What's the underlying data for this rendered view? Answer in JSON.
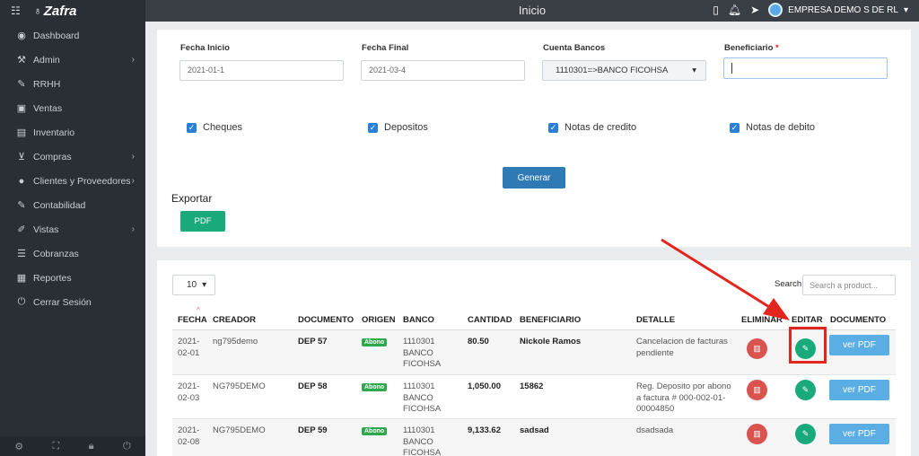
{
  "app": {
    "name": "Zafra"
  },
  "header": {
    "title": "Inicio",
    "org": "EMPRESA DEMO S DE RL",
    "org_caret": "▾"
  },
  "sidebar": {
    "items": [
      {
        "label": "Dashboard",
        "icon": "dashboard-icon",
        "glyph": "◉",
        "chevron": false
      },
      {
        "label": "Admin",
        "icon": "wrench-icon",
        "glyph": "⚒",
        "chevron": true
      },
      {
        "label": "RRHH",
        "icon": "tag-icon",
        "glyph": "✎",
        "chevron": false
      },
      {
        "label": "Ventas",
        "icon": "money-icon",
        "glyph": "▣",
        "chevron": false
      },
      {
        "label": "Inventario",
        "icon": "book-icon",
        "glyph": "▤",
        "chevron": false
      },
      {
        "label": "Compras",
        "icon": "cart-icon",
        "glyph": "⊻",
        "chevron": true
      },
      {
        "label": "Clientes y Proveedores",
        "icon": "user-icon",
        "glyph": "●",
        "chevron": true
      },
      {
        "label": "Contabilidad",
        "icon": "pencil-icon",
        "glyph": "✎",
        "chevron": false
      },
      {
        "label": "Vistas",
        "icon": "edit-icon",
        "glyph": "✐",
        "chevron": true
      },
      {
        "label": "Cobranzas",
        "icon": "list-icon",
        "glyph": "☰",
        "chevron": false
      },
      {
        "label": "Reportes",
        "icon": "report-icon",
        "glyph": "▦",
        "chevron": false
      },
      {
        "label": "Cerrar Sesión",
        "icon": "power-icon",
        "glyph": "⏻",
        "chevron": false
      }
    ]
  },
  "filters": {
    "fecha_inicio_label": "Fecha Inicio",
    "fecha_inicio_value": "2021-01-1",
    "fecha_final_label": "Fecha Final",
    "fecha_final_value": "2021-03-4",
    "cuenta_label": "Cuenta Bancos",
    "cuenta_value": "1110301=>BANCO FICOHSA",
    "beneficiario_label": "Beneficiario",
    "beneficiario_required": "*",
    "beneficiario_value": ""
  },
  "checkboxes": [
    {
      "label": "Cheques",
      "checked": true
    },
    {
      "label": "Depositos",
      "checked": true
    },
    {
      "label": "Notas de credito",
      "checked": true
    },
    {
      "label": "Notas de debito",
      "checked": true
    }
  ],
  "actions": {
    "generar": "Generar",
    "exportar": "Exportar",
    "pdf": "PDF"
  },
  "table": {
    "length": "10",
    "search_label": "Search:",
    "search_placeholder": "Search a product...",
    "columns": [
      "FECHA",
      "CREADOR",
      "DOCUMENTO",
      "ORIGEN",
      "BANCO",
      "CANTIDAD",
      "BENEFICIARIO",
      "DETALLE",
      "ELIMINAR",
      "EDITAR",
      "DOCUMENTO"
    ],
    "ver_pdf": "ver PDF",
    "rows": [
      {
        "fecha": [
          "2021-",
          "02-01"
        ],
        "creador": "ng795demo",
        "documento": "DEP 57",
        "origen": "Abono",
        "banco": [
          "1110301",
          "BANCO",
          "FICOHSA"
        ],
        "cantidad": "80.50",
        "beneficiario": "Nickole Ramos",
        "detalle": [
          "Cancelacion de facturas",
          "pendiente"
        ]
      },
      {
        "fecha": [
          "2021-",
          "02-03"
        ],
        "creador": "NG795DEMO",
        "documento": "DEP 58",
        "origen": "Abono",
        "banco": [
          "1110301",
          "BANCO",
          "FICOHSA"
        ],
        "cantidad": "1,050.00",
        "beneficiario": "15862",
        "detalle": [
          "Reg. Deposito por abono",
          "a factura # 000-002-01-",
          "00004850"
        ]
      },
      {
        "fecha": [
          "2021-",
          "02-08"
        ],
        "creador": "NG795DEMO",
        "documento": "DEP 59",
        "origen": "Abono",
        "banco": [
          "1110301",
          "BANCO",
          "FICOHSA"
        ],
        "cantidad": "9,133.62",
        "beneficiario": "sadsad",
        "detalle": [
          "dsadsada"
        ]
      }
    ]
  }
}
